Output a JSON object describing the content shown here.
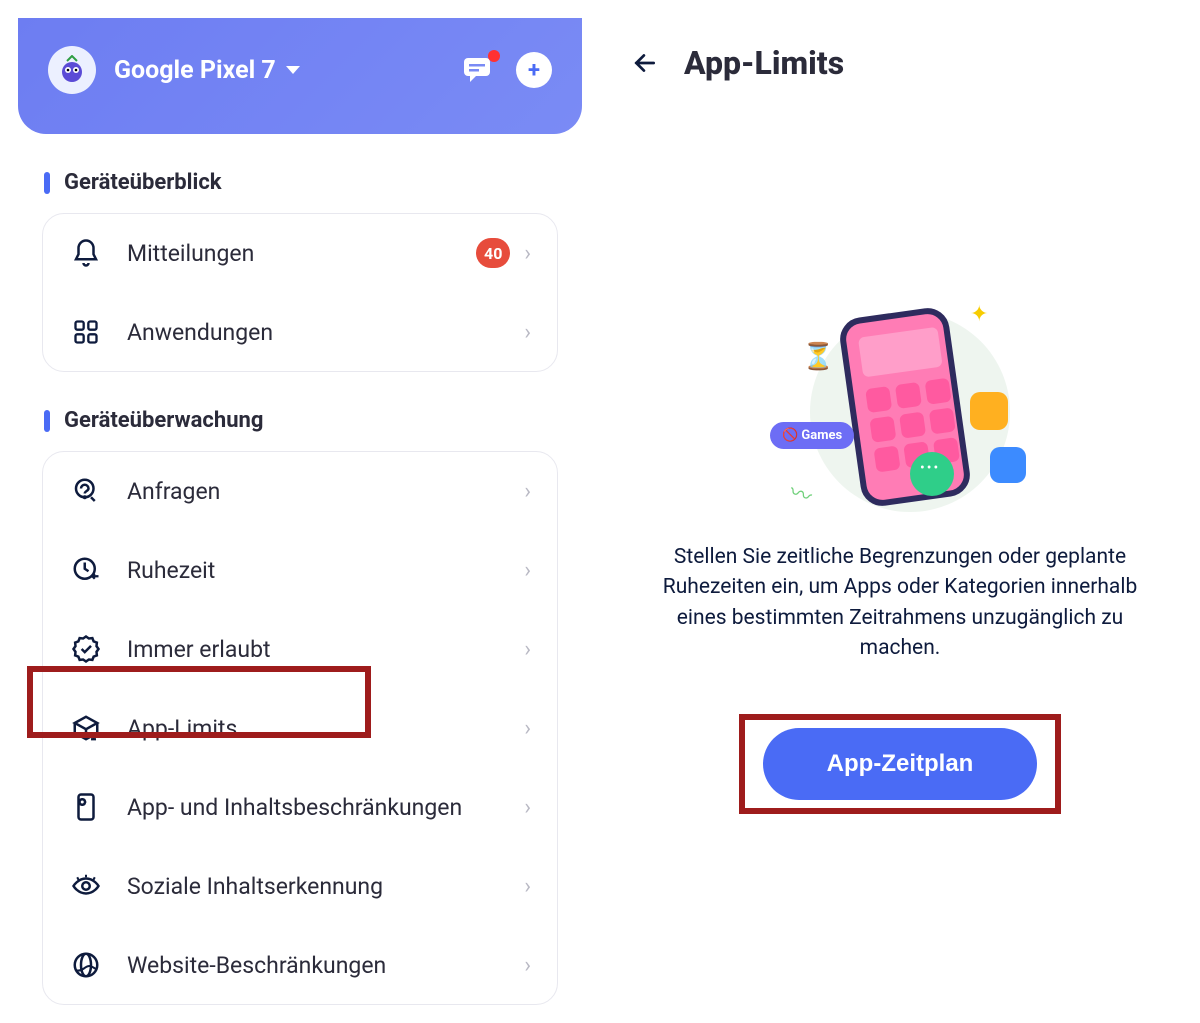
{
  "header": {
    "device_name": "Google Pixel 7"
  },
  "sidebar": {
    "section1": {
      "title": "Geräteüberblick",
      "items": [
        {
          "label": "Mitteilungen",
          "badge": "40"
        },
        {
          "label": "Anwendungen"
        }
      ]
    },
    "section2": {
      "title": "Geräteüberwachung",
      "items": [
        {
          "label": "Anfragen"
        },
        {
          "label": "Ruhezeit"
        },
        {
          "label": "Immer erlaubt"
        },
        {
          "label": "App-Limits"
        },
        {
          "label": "App- und Inhaltsbeschränkungen"
        },
        {
          "label": "Soziale Inhaltserkennung"
        },
        {
          "label": "Website-Beschränkungen"
        }
      ]
    }
  },
  "main": {
    "title": "App-Limits",
    "illustration_label": "Games",
    "empty_text": "Stellen Sie zeitliche Begrenzungen oder geplante Ruhezeiten ein, um Apps oder Kategorien innerhalb eines bestimmten Zeitrahmens unzugänglich zu machen.",
    "button_label": "App-Zeitplan"
  }
}
